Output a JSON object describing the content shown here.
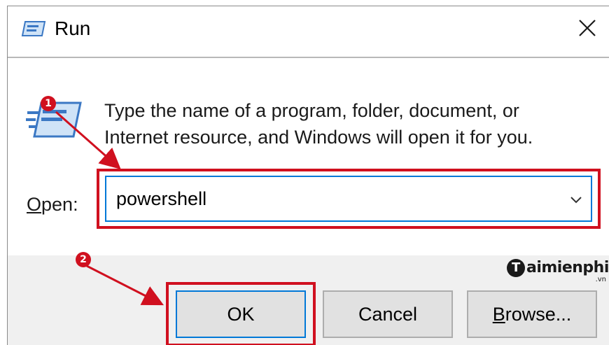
{
  "window": {
    "title": "Run",
    "icon": "run-dialog-icon",
    "close_icon": "close-icon"
  },
  "body": {
    "icon": "run-program-icon",
    "description": "Type the name of a program, folder, document, or Internet resource, and Windows will open it for you."
  },
  "open_field": {
    "label_mnemonic": "O",
    "label_rest": "pen:",
    "value": "powershell",
    "dropdown_icon": "chevron-down-icon"
  },
  "buttons": {
    "ok": "OK",
    "cancel": "Cancel",
    "browse_mnemonic": "B",
    "browse_rest": "rowse..."
  },
  "annotations": {
    "marker_1": "1",
    "marker_2": "2",
    "highlight_color": "#d0101f"
  },
  "watermark": {
    "logo_letter": "T",
    "text": "aimienphi",
    "sub": ".vn"
  },
  "colors": {
    "accent": "#0078d7",
    "footer_bg": "#f0f0f0",
    "button_bg": "#e1e1e1"
  }
}
